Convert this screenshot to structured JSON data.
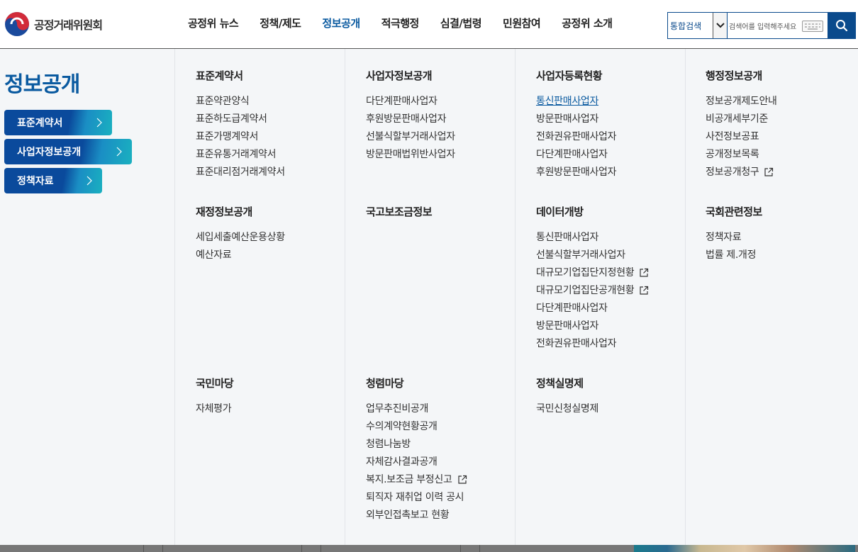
{
  "header": {
    "logo_text": "공정거래위원회",
    "nav": [
      {
        "label": "공정위 뉴스",
        "active": false
      },
      {
        "label": "정책/제도",
        "active": false
      },
      {
        "label": "정보공개",
        "active": true
      },
      {
        "label": "적극행정",
        "active": false
      },
      {
        "label": "심결/법령",
        "active": false
      },
      {
        "label": "민원참여",
        "active": false
      },
      {
        "label": "공정위 소개",
        "active": false
      }
    ],
    "search": {
      "scope_selected": "통합검색",
      "placeholder": "검색어를 입력해주세요"
    }
  },
  "sidebar": {
    "title": "정보공개",
    "buttons": [
      {
        "label": "표준계약서"
      },
      {
        "label": "사업자정보공개"
      },
      {
        "label": "정책자료"
      }
    ]
  },
  "menu": {
    "groups": [
      {
        "title": "표준계약서",
        "items": [
          {
            "label": "표준약관양식"
          },
          {
            "label": "표준하도급계약서"
          },
          {
            "label": "표준가맹계약서"
          },
          {
            "label": "표준유통거래계약서"
          },
          {
            "label": "표준대리점거래계약서"
          }
        ]
      },
      {
        "title": "사업자정보공개",
        "items": [
          {
            "label": "다단계판매사업자"
          },
          {
            "label": "후원방문판매사업자"
          },
          {
            "label": "선불식할부거래사업자"
          },
          {
            "label": "방문판매법위반사업자"
          }
        ]
      },
      {
        "title": "사업자등록현황",
        "items": [
          {
            "label": "통신판매사업자",
            "hover": true
          },
          {
            "label": "방문판매사업자"
          },
          {
            "label": "전화권유판매사업자"
          },
          {
            "label": "다단계판매사업자"
          },
          {
            "label": "후원방문판매사업자"
          }
        ]
      },
      {
        "title": "행정정보공개",
        "items": [
          {
            "label": "정보공개제도안내"
          },
          {
            "label": "비공개세부기준"
          },
          {
            "label": "사전정보공표"
          },
          {
            "label": "공개정보목록"
          },
          {
            "label": "정보공개청구",
            "external": true
          }
        ]
      },
      {
        "title": "재정정보공개",
        "items": [
          {
            "label": "세입세출예산운용상황"
          },
          {
            "label": "예산자료"
          }
        ]
      },
      {
        "title": "국고보조금정보",
        "items": []
      },
      {
        "title": "데이터개방",
        "items": [
          {
            "label": "통신판매사업자"
          },
          {
            "label": "선불식할부거래사업자"
          },
          {
            "label": "대규모기업집단지정현황",
            "external": true
          },
          {
            "label": "대규모기업집단공개현황",
            "external": true
          },
          {
            "label": "다단계판매사업자"
          },
          {
            "label": "방문판매사업자"
          },
          {
            "label": "전화권유판매사업자"
          }
        ]
      },
      {
        "title": "국회관련정보",
        "items": [
          {
            "label": "정책자료"
          },
          {
            "label": "법률 제.개정"
          }
        ]
      },
      {
        "title": "국민마당",
        "items": [
          {
            "label": "자체평가"
          }
        ]
      },
      {
        "title": "청렴마당",
        "items": [
          {
            "label": "업무추진비공개"
          },
          {
            "label": "수의계약현황공개"
          },
          {
            "label": "청렴나눔방"
          },
          {
            "label": "자체감사결과공개"
          },
          {
            "label": "복지.보조금 부정신고",
            "external": true
          },
          {
            "label": "퇴직자 재취업 이력 공시"
          },
          {
            "label": "외부인접촉보고 현황"
          }
        ]
      },
      {
        "title": "정책실명제",
        "items": [
          {
            "label": "국민신청실명제"
          }
        ]
      }
    ]
  },
  "colors": {
    "brand_blue": "#0a4a8c",
    "active_nav": "#0a5aa0",
    "menu_bg": "#f4f6f8"
  }
}
